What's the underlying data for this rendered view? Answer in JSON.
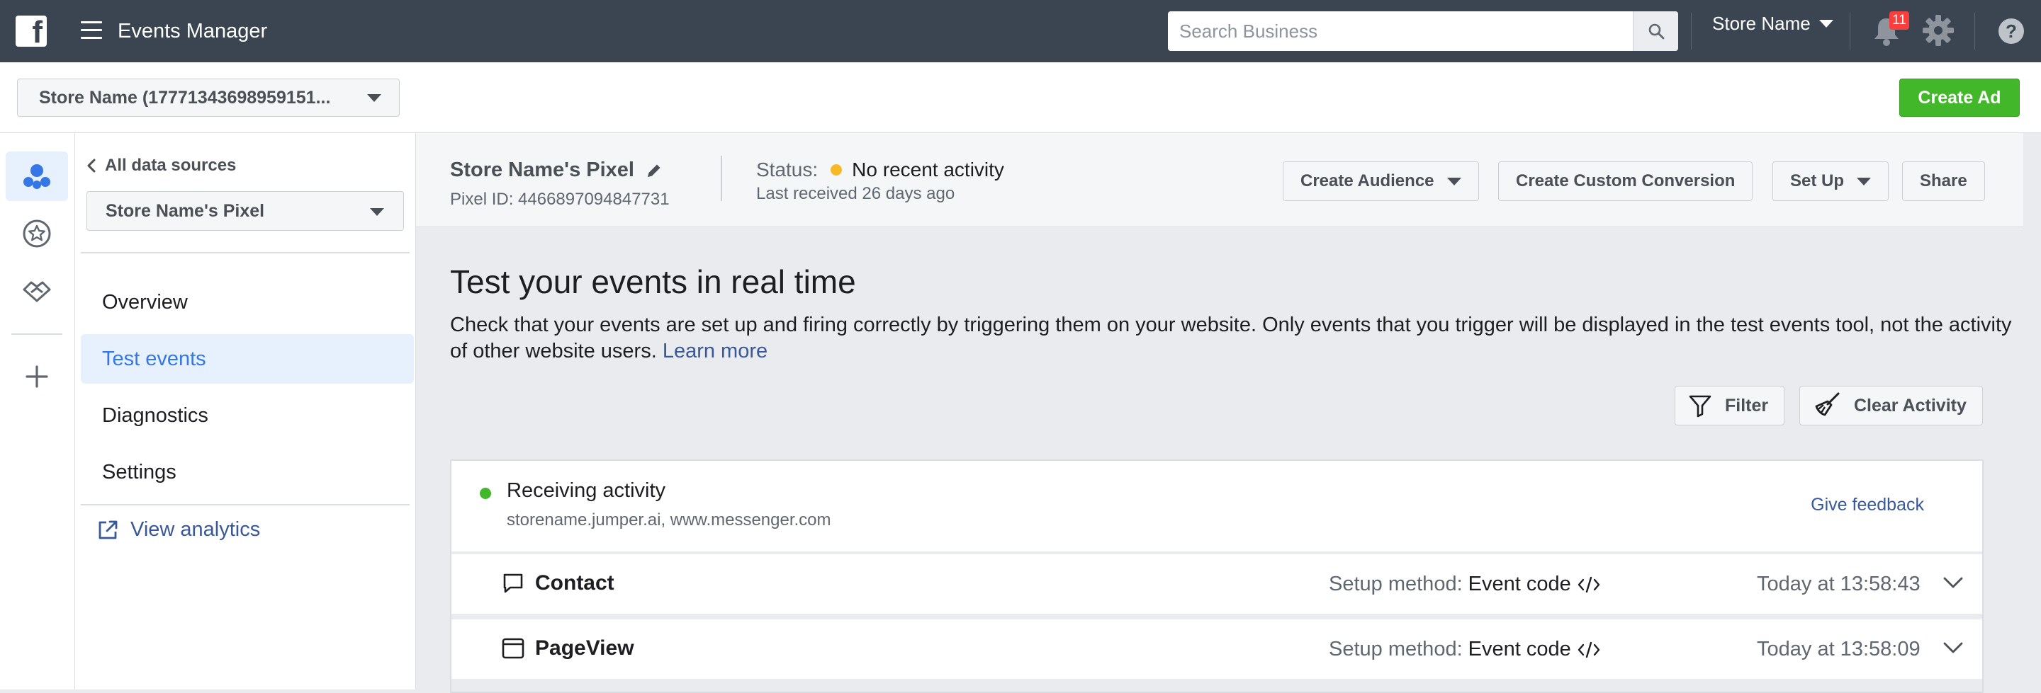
{
  "app": {
    "title": "Events Manager"
  },
  "topbar": {
    "search_placeholder": "Search Business",
    "store_name": "Store Name",
    "notification_count": "11",
    "help_label": "?"
  },
  "subbar": {
    "store_select": "Store Name (17771343698959151...",
    "create_ad": "Create Ad"
  },
  "leftnav": {
    "back_label": "All data sources",
    "pixel_select": "Store Name's Pixel",
    "items": [
      {
        "label": "Overview"
      },
      {
        "label": "Test events"
      },
      {
        "label": "Diagnostics"
      },
      {
        "label": "Settings"
      }
    ],
    "active_item": "Test events",
    "view_analytics": "View analytics"
  },
  "header": {
    "pixel_name": "Store Name's Pixel",
    "pixel_id": "Pixel ID: 4466897094847731",
    "status_label": "Status:",
    "status_value": "No recent activity",
    "last_received": "Last received 26 days ago",
    "buttons": {
      "create_audience": "Create Audience",
      "create_custom_conversion": "Create Custom Conversion",
      "set_up": "Set Up",
      "share": "Share"
    }
  },
  "main": {
    "title": "Test your events in real time",
    "description": "Check that your events are set up and firing correctly by triggering them on your website. Only events that you trigger will be displayed in the test events tool, not the activity of other website users.",
    "learn_more": "Learn more",
    "filter": "Filter",
    "clear_activity": "Clear Activity",
    "receiving": {
      "title": "Receiving activity",
      "domains": "storename.jumper.ai, www.messenger.com",
      "give_feedback": "Give feedback"
    },
    "events": [
      {
        "name": "Contact",
        "setup_label": "Setup method:",
        "setup_value": "Event code",
        "time": "Today at 13:58:43",
        "icon": "chat-bubble-icon"
      },
      {
        "name": "PageView",
        "setup_label": "Setup method:",
        "setup_value": "Event code",
        "time": "Today at 13:58:09",
        "icon": "browser-window-icon"
      }
    ]
  },
  "colors": {
    "topbar": "#3b4552",
    "accent_blue": "#3578e5",
    "link_blue": "#385898",
    "create_ad_green": "#42b72a",
    "status_yellow": "#f7b928",
    "active_green": "#42b72a",
    "badge_red": "#fa3e3e"
  }
}
